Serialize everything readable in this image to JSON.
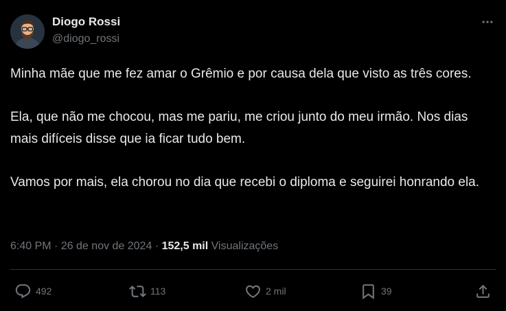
{
  "author": {
    "display_name": "Diogo Rossi",
    "handle": "@diogo_rossi"
  },
  "tweet": {
    "paragraphs": [
      "Minha mãe que me fez amar o Grêmio e por causa dela que visto as três cores.",
      "Ela, que não me chocou, mas me pariu, me criou junto do meu irmão. Nos dias mais difíceis disse que ia ficar tudo bem.",
      "Vamos por mais, ela chorou no dia que recebi o diploma e seguirei honrando ela."
    ]
  },
  "meta": {
    "time": "6:40 PM",
    "separator1": " · ",
    "date": "26 de nov de 2024",
    "separator2": " · ",
    "views_count": "152,5 mil",
    "views_label": " Visualizações"
  },
  "actions": {
    "replies": "492",
    "reposts": "113",
    "likes": "2 mil",
    "bookmarks": "39"
  },
  "icons": {
    "more": "more-horizontal-icon",
    "reply": "reply-icon",
    "repost": "repost-icon",
    "like": "heart-icon",
    "bookmark": "bookmark-icon",
    "share": "share-icon"
  },
  "colors": {
    "background": "#000000",
    "text_primary": "#e7e9ea",
    "text_secondary": "#71767b",
    "divider": "#2f3336"
  }
}
